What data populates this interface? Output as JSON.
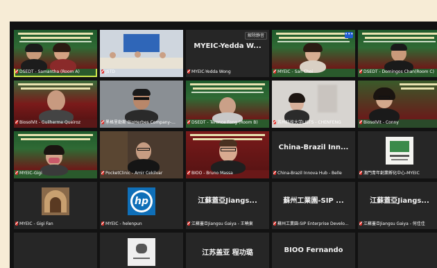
{
  "toolbar": {
    "unmute_label": "解除静音",
    "more_label": "•••"
  },
  "tiles": [
    {
      "caption": "DSEDT - Samantha (Room A)"
    },
    {
      "caption": "JSTD"
    },
    {
      "caption": "MYEIC-Yedda Wong",
      "big": "MYEIC-Yedda W..."
    },
    {
      "caption": "MYEIC - San Choi"
    },
    {
      "caption": "DSEDT - Domingos Chan(Room C)"
    },
    {
      "caption": "BiosolVit - Guilherme Queiroz"
    },
    {
      "caption": "黑格里勒斯 BioHerbes Company-..."
    },
    {
      "caption": "DSEDT - Terence Fong (Room B)"
    },
    {
      "caption": "苏州科技大学LISTS - CHENFENG"
    },
    {
      "caption": "BiosolVit - Conny"
    },
    {
      "caption": "MYEIC-Gigi"
    },
    {
      "caption": "PocketClinic - Amir Cekilvar"
    },
    {
      "caption": "BIOO - Bruno Massa"
    },
    {
      "caption": "China-Brazil Innova Hub - Belle",
      "big": "China-Brazil Inn..."
    },
    {
      "caption": "澳門青年創業孵化中心-MYEIC"
    },
    {
      "caption": "MYEIC - Gigi Fan"
    },
    {
      "caption": "MYEIC - helenpun"
    },
    {
      "caption": "江蘇蓋亞Jiangsu Gaiya - 王曉東",
      "big": "江蘇蓋亞Jiangs..."
    },
    {
      "caption": "蘇州工業園-SIP Enterprise Develo...",
      "big": "蘇州工業園-SIP ..."
    },
    {
      "caption": "江蘇蓋亞Jiangsu Gaiya - 何佳佳",
      "big": "江蘇蓋亞Jiangs..."
    },
    {
      "caption": ""
    },
    {
      "caption": ""
    },
    {
      "caption": "",
      "big": "江苏盖亚 程功璐"
    },
    {
      "caption": "",
      "big": "BIOO Fernando"
    }
  ]
}
